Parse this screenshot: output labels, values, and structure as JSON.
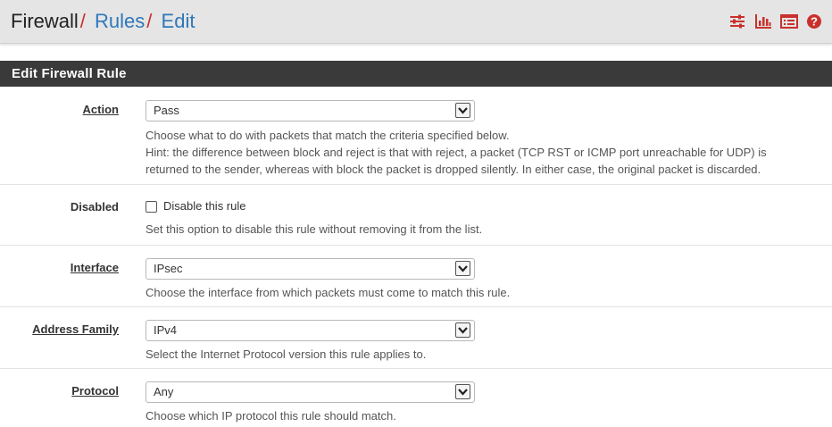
{
  "breadcrumb": {
    "first": "Firewall",
    "second": "Rules",
    "third": "Edit",
    "separator": "/"
  },
  "toolbar": {
    "icons": [
      "sliders-icon",
      "bar-chart-icon",
      "list-icon",
      "help-icon"
    ],
    "accent": "#c9302c"
  },
  "panel": {
    "title": "Edit Firewall Rule"
  },
  "fields": {
    "action": {
      "label": "Action",
      "value": "Pass",
      "help": [
        "Choose what to do with packets that match the criteria specified below.",
        "Hint: the difference between block and reject is that with reject, a packet (TCP RST or ICMP port unreachable for UDP) is",
        "returned to the sender, whereas with block the packet is dropped silently. In either case, the original packet is discarded."
      ]
    },
    "disabled": {
      "label": "Disabled",
      "checkbox_label": "Disable this rule",
      "checked": false,
      "help": "Set this option to disable this rule without removing it from the list."
    },
    "interface": {
      "label": "Interface",
      "value": "IPsec",
      "help": "Choose the interface from which packets must come to match this rule."
    },
    "address_family": {
      "label": "Address Family",
      "value": "IPv4",
      "help": "Select the Internet Protocol version this rule applies to."
    },
    "protocol": {
      "label": "Protocol",
      "value": "Any",
      "help": "Choose which IP protocol this rule should match."
    }
  }
}
